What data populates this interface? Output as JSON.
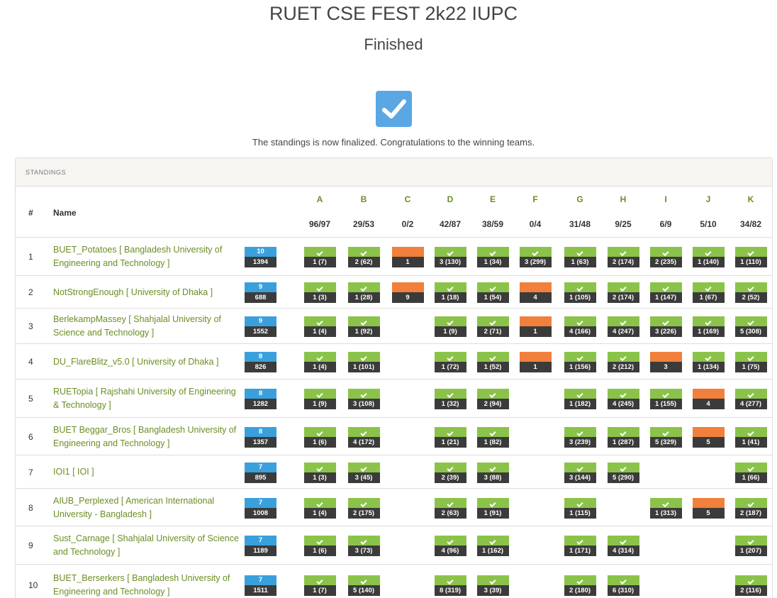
{
  "header": {
    "title": "RUET CSE FEST 2k22 IUPC",
    "status": "Finished",
    "message": "The standings is now finalized. Congratulations to the winning teams."
  },
  "standings": {
    "panel_title": "STANDINGS",
    "col_rank": "#",
    "col_name": "Name",
    "problems": [
      {
        "id": "A",
        "stat": "96/97"
      },
      {
        "id": "B",
        "stat": "29/53"
      },
      {
        "id": "C",
        "stat": "0/2"
      },
      {
        "id": "D",
        "stat": "42/87"
      },
      {
        "id": "E",
        "stat": "38/59"
      },
      {
        "id": "F",
        "stat": "0/4"
      },
      {
        "id": "G",
        "stat": "31/48"
      },
      {
        "id": "H",
        "stat": "9/25"
      },
      {
        "id": "I",
        "stat": "6/9"
      },
      {
        "id": "J",
        "stat": "5/10"
      },
      {
        "id": "K",
        "stat": "34/82"
      }
    ],
    "rows": [
      {
        "rank": "1",
        "team": "BUET_Potatoes [ Bangladesh University of Engineering and Technology ]",
        "solved": "10",
        "penalty": "1394",
        "cells": [
          [
            "s",
            "1 (7)"
          ],
          [
            "s",
            "2 (62)"
          ],
          [
            "t",
            "1"
          ],
          [
            "s",
            "3 (130)"
          ],
          [
            "s",
            "1 (34)"
          ],
          [
            "s",
            "3 (299)"
          ],
          [
            "s",
            "1 (63)"
          ],
          [
            "s",
            "2 (174)"
          ],
          [
            "s",
            "2 (235)"
          ],
          [
            "s",
            "1 (140)"
          ],
          [
            "s",
            "1 (110)"
          ]
        ]
      },
      {
        "rank": "2",
        "team": "NotStrongEnough [ University of Dhaka ]",
        "solved": "9",
        "penalty": "688",
        "cells": [
          [
            "s",
            "1 (3)"
          ],
          [
            "s",
            "1 (28)"
          ],
          [
            "t",
            "9"
          ],
          [
            "s",
            "1 (18)"
          ],
          [
            "s",
            "1 (54)"
          ],
          [
            "t",
            "4"
          ],
          [
            "s",
            "1 (105)"
          ],
          [
            "s",
            "2 (174)"
          ],
          [
            "s",
            "1 (147)"
          ],
          [
            "s",
            "1 (67)"
          ],
          [
            "s",
            "2 (52)"
          ]
        ]
      },
      {
        "rank": "3",
        "team": "BerlekampMassey [ Shahjalal University of Science and Technology ]",
        "solved": "9",
        "penalty": "1552",
        "cells": [
          [
            "s",
            "1 (4)"
          ],
          [
            "s",
            "1 (92)"
          ],
          null,
          [
            "s",
            "1 (9)"
          ],
          [
            "s",
            "2 (71)"
          ],
          [
            "t",
            "1"
          ],
          [
            "s",
            "4 (166)"
          ],
          [
            "s",
            "4 (247)"
          ],
          [
            "s",
            "3 (226)"
          ],
          [
            "s",
            "1 (169)"
          ],
          [
            "s",
            "5 (308)"
          ]
        ]
      },
      {
        "rank": "4",
        "team": "DU_FlareBlitz_v5.0 [ University of Dhaka ]",
        "solved": "8",
        "penalty": "826",
        "cells": [
          [
            "s",
            "1 (4)"
          ],
          [
            "s",
            "1 (101)"
          ],
          null,
          [
            "s",
            "1 (72)"
          ],
          [
            "s",
            "1 (52)"
          ],
          [
            "t",
            "1"
          ],
          [
            "s",
            "1 (156)"
          ],
          [
            "s",
            "2 (212)"
          ],
          [
            "t",
            "3"
          ],
          [
            "s",
            "1 (134)"
          ],
          [
            "s",
            "1 (75)"
          ]
        ]
      },
      {
        "rank": "5",
        "team": "RUETopia [ Rajshahi University of Engineering & Technology ]",
        "solved": "8",
        "penalty": "1282",
        "cells": [
          [
            "s",
            "1 (9)"
          ],
          [
            "s",
            "3 (108)"
          ],
          null,
          [
            "s",
            "1 (32)"
          ],
          [
            "s",
            "2 (94)"
          ],
          null,
          [
            "s",
            "1 (182)"
          ],
          [
            "s",
            "4 (245)"
          ],
          [
            "s",
            "1 (155)"
          ],
          [
            "t",
            "4"
          ],
          [
            "s",
            "4 (277)"
          ]
        ]
      },
      {
        "rank": "6",
        "team": "BUET Beggar_Bros [ Bangladesh University of Engineering and Technology ]",
        "solved": "8",
        "penalty": "1357",
        "cells": [
          [
            "s",
            "1 (6)"
          ],
          [
            "s",
            "4 (172)"
          ],
          null,
          [
            "s",
            "1 (21)"
          ],
          [
            "s",
            "1 (82)"
          ],
          null,
          [
            "s",
            "3 (239)"
          ],
          [
            "s",
            "1 (287)"
          ],
          [
            "s",
            "5 (329)"
          ],
          [
            "t",
            "5"
          ],
          [
            "s",
            "1 (41)"
          ]
        ]
      },
      {
        "rank": "7",
        "team": "IOI1 [ IOI ]",
        "solved": "7",
        "penalty": "895",
        "cells": [
          [
            "s",
            "1 (3)"
          ],
          [
            "s",
            "3 (45)"
          ],
          null,
          [
            "s",
            "2 (39)"
          ],
          [
            "s",
            "3 (88)"
          ],
          null,
          [
            "s",
            "3 (144)"
          ],
          [
            "s",
            "5 (290)"
          ],
          null,
          null,
          [
            "s",
            "1 (66)"
          ]
        ]
      },
      {
        "rank": "8",
        "team": "AIUB_Perplexed [ American International University - Bangladesh ]",
        "solved": "7",
        "penalty": "1008",
        "cells": [
          [
            "s",
            "1 (4)"
          ],
          [
            "s",
            "2 (175)"
          ],
          null,
          [
            "s",
            "2 (63)"
          ],
          [
            "s",
            "1 (91)"
          ],
          null,
          [
            "s",
            "1 (115)"
          ],
          null,
          [
            "s",
            "1 (313)"
          ],
          [
            "t",
            "5"
          ],
          [
            "s",
            "2 (187)"
          ]
        ]
      },
      {
        "rank": "9",
        "team": "Sust_Carnage [ Shahjalal University of Science and Technology ]",
        "solved": "7",
        "penalty": "1189",
        "cells": [
          [
            "s",
            "1 (6)"
          ],
          [
            "s",
            "3 (73)"
          ],
          null,
          [
            "s",
            "4 (96)"
          ],
          [
            "s",
            "1 (162)"
          ],
          null,
          [
            "s",
            "1 (171)"
          ],
          [
            "s",
            "4 (314)"
          ],
          null,
          null,
          [
            "s",
            "1 (207)"
          ]
        ]
      },
      {
        "rank": "10",
        "team": "BUET_Berserkers [ Bangladesh University of Engineering and Technology ]",
        "solved": "7",
        "penalty": "1511",
        "cells": [
          [
            "s",
            "1 (7)"
          ],
          [
            "s",
            "5 (140)"
          ],
          null,
          [
            "s",
            "8 (319)"
          ],
          [
            "s",
            "3 (39)"
          ],
          null,
          [
            "s",
            "2 (180)"
          ],
          [
            "s",
            "6 (310)"
          ],
          null,
          null,
          [
            "s",
            "2 (116)"
          ]
        ]
      }
    ]
  },
  "colors": {
    "solved": "#8bc34a",
    "tried": "#f0803c",
    "score": "#3aa0dc",
    "dark": "#3b3b3b",
    "team_link": "#6b8e23"
  }
}
